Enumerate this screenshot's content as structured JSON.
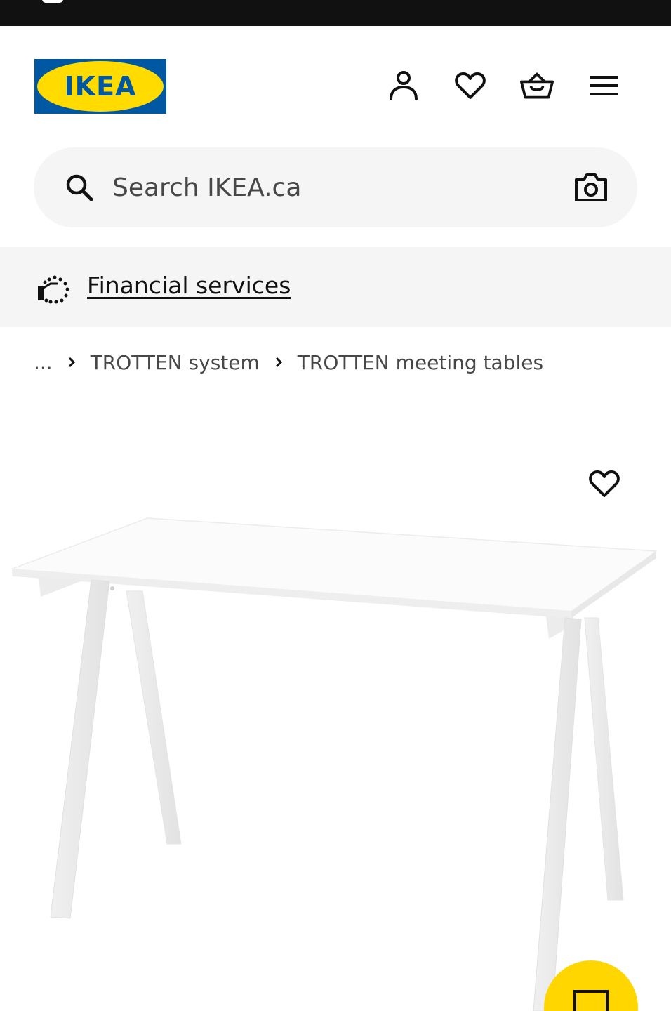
{
  "header": {
    "logo_text": "IKEA",
    "icons": [
      "profile-icon",
      "heart-icon",
      "shopping-bag-icon",
      "hamburger-menu-icon"
    ]
  },
  "search": {
    "placeholder": "Search IKEA.ca",
    "icon": "search-icon",
    "visual_search_icon": "camera-icon"
  },
  "banner": {
    "icon": "financial-services-icon",
    "link_text": "Financial services"
  },
  "breadcrumb": {
    "ellipsis": "...",
    "items": [
      {
        "label": "TROTTEN system"
      },
      {
        "label": "TROTTEN meeting tables"
      }
    ]
  },
  "product": {
    "image": "white-table-with-trestle-legs",
    "favourite_icon": "heart-outline-icon"
  },
  "colors": {
    "brand_blue": "#0058a3",
    "brand_yellow": "#ffdb00",
    "fab_yellow": "#ffd600",
    "banner_bg": "#f5f5f5",
    "text": "#111111"
  }
}
